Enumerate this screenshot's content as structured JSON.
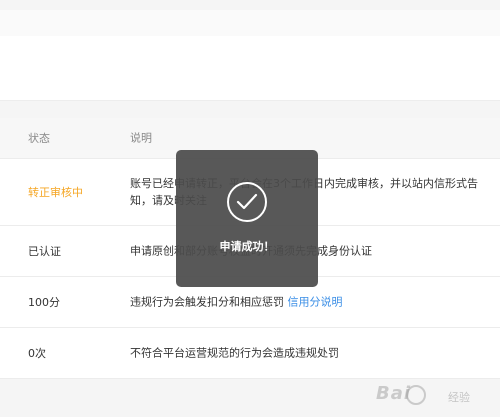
{
  "table": {
    "header": {
      "status": "状态",
      "description": "说明"
    },
    "rows": [
      {
        "status": "转正审核中",
        "status_color": "#f5a623",
        "description": "账号已经申请转正，平台会在3个工作日内完成审核，并以站内信形式告知，请及时关注"
      },
      {
        "status": "已认证",
        "description": "申请原创和部分账号权益时开通须先完成身份认证"
      },
      {
        "status": "100分",
        "description": "违规行为会触发扣分和相应惩罚",
        "link": "信用分说明"
      },
      {
        "status": "0次",
        "description": "不符合平台运营规范的行为会造成违规处罚"
      }
    ]
  },
  "toast": {
    "message": "申请成功！",
    "icon": "checkmark-circle-icon"
  },
  "watermark": {
    "text": "Bai",
    "suffix": "经验"
  },
  "colors": {
    "accent": "#3a8ee6",
    "warning": "#f5a623"
  }
}
